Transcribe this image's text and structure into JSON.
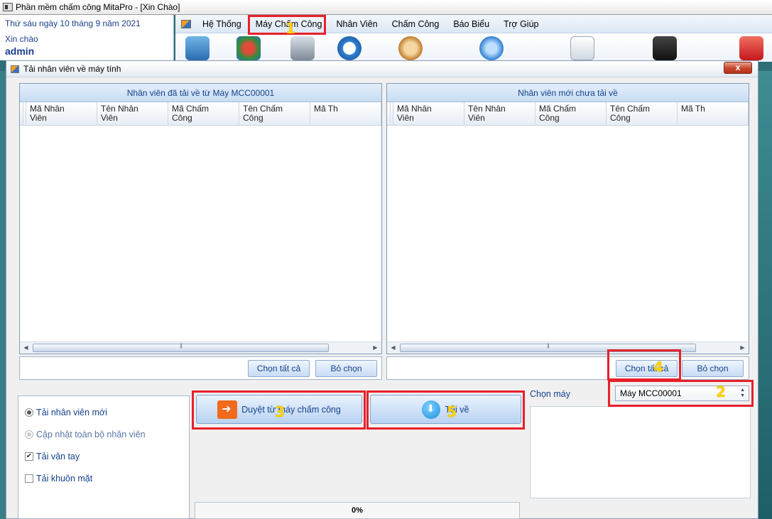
{
  "app": {
    "title": "Phần mềm chấm công MitaPro - [Xin Chào]",
    "date_line": "Thứ sáu ngày 10 tháng 9 năm 2021",
    "greeting": "Xin chào",
    "username": "admin"
  },
  "menu": {
    "items": [
      "Hệ Thống",
      "Máy Chấm Công",
      "Nhân Viên",
      "Chấm Công",
      "Báo Biểu",
      "Trợ Giúp"
    ]
  },
  "dialog": {
    "title": "Tải nhân viên về máy tính",
    "close_label": "x"
  },
  "left_grid": {
    "caption": "Nhân viên đã tải về từ Máy MCC00001",
    "columns": [
      "Mã Nhân\nViên",
      "Tên Nhân\nViên",
      "Mã Chấm\nCông",
      "Tên Chấm\nCông",
      "Mã Th"
    ],
    "select_all_label": "Chọn tất cả",
    "deselect_label": "Bỏ chọn"
  },
  "right_grid": {
    "caption": "Nhân viên mới chưa tải về",
    "columns": [
      "Mã Nhân\nViên",
      "Tên Nhân\nViên",
      "Mã Chấm\nCông",
      "Tên Chấm\nCông",
      "Mã Th"
    ],
    "select_all_label": "Chọn tất cả",
    "deselect_label": "Bỏ chọn"
  },
  "options": {
    "new_employees": "Tải nhân viên mới",
    "update_all": "Cập nhật toàn bộ nhân viên",
    "fingerprint": "Tải vân tay",
    "face": "Tải khuôn mặt",
    "selected_radio": "new_employees",
    "fingerprint_checked": true,
    "face_checked": false
  },
  "actions": {
    "browse_label": "Duyệt từ máy chấm công",
    "download_label": "Tải về"
  },
  "progress": {
    "text": "0%",
    "value": 0
  },
  "machine": {
    "label": "Chọn máy",
    "selected": "Máy MCC00001"
  },
  "annotations": {
    "color": "#e8202a",
    "number_color": "#ffd200",
    "numbers": [
      "1",
      "2",
      "3",
      "4",
      "5"
    ]
  }
}
